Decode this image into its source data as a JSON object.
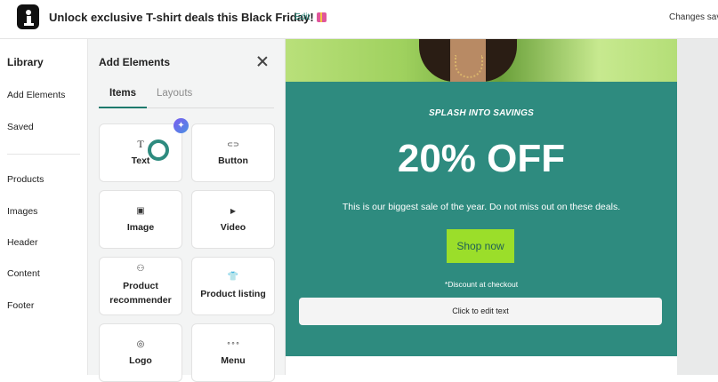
{
  "header": {
    "title": "Unlock exclusive T-shirt deals this Black Friday!",
    "edit_label": "Edit",
    "status": "Changes save"
  },
  "sidebar": {
    "heading": "Library",
    "items": [
      {
        "label": "Add Elements"
      },
      {
        "label": "Saved"
      },
      {
        "label": "Products"
      },
      {
        "label": "Images"
      },
      {
        "label": "Header"
      },
      {
        "label": "Content"
      },
      {
        "label": "Footer"
      }
    ]
  },
  "panel": {
    "title": "Add Elements",
    "tabs": [
      {
        "label": "Items",
        "active": true
      },
      {
        "label": "Layouts",
        "active": false
      }
    ],
    "elements": [
      {
        "label": "Text",
        "icon": "T"
      },
      {
        "label": "Button",
        "icon": "⊂⊃"
      },
      {
        "label": "Image",
        "icon": "▣"
      },
      {
        "label": "Video",
        "icon": "▶"
      },
      {
        "label": "Product recommender",
        "icon": "⚇"
      },
      {
        "label": "Product listing",
        "icon": "👕"
      },
      {
        "label": "Logo",
        "icon": "◎"
      },
      {
        "label": "Menu",
        "icon": "∘∘∘"
      }
    ]
  },
  "email": {
    "eyebrow": "SPLASH INTO SAVINGS",
    "headline": "20% OFF",
    "body": "This is our biggest sale of the year. Do not miss out on these deals.",
    "cta": "Shop now",
    "disclaimer": "*Discount at checkout",
    "edit_placeholder": "Click to edit text"
  },
  "colors": {
    "accent": "#1e7a6d",
    "promo_bg": "#2e8b7f",
    "cta_bg": "#9bde2a"
  }
}
